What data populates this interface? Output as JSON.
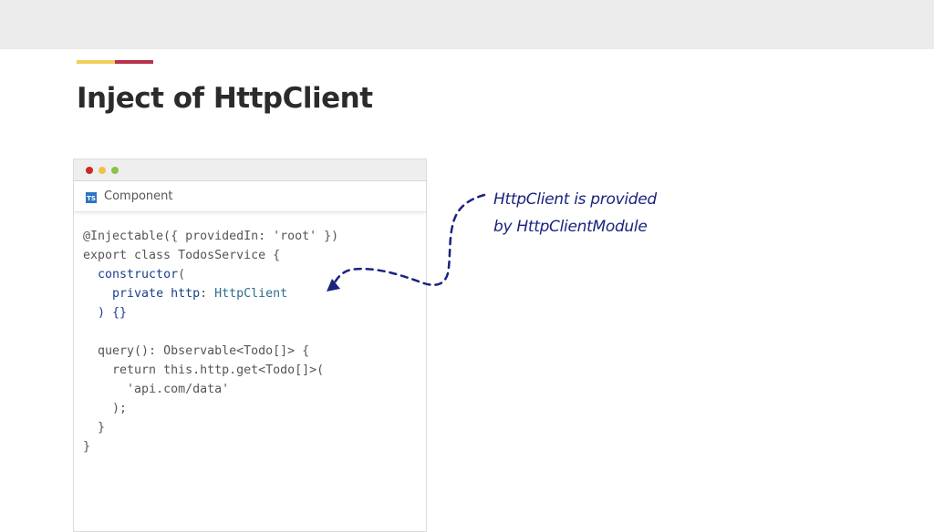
{
  "slide": {
    "title": "Inject of HttpClient",
    "colors": {
      "band": "#ebebeb",
      "accent_yellow": "#f2cd5c",
      "accent_red": "#b8324b",
      "annotation": "#1a237e"
    }
  },
  "editor": {
    "window_dots": [
      "close",
      "minimize",
      "maximize"
    ],
    "tab": {
      "icon": "typescript-icon",
      "icon_text": "TS",
      "label": "Component"
    },
    "code_lines": [
      {
        "indent": "",
        "parts": [
          {
            "text": "@Injectable({ providedIn: 'root' })",
            "style": "plain"
          }
        ]
      },
      {
        "indent": "",
        "parts": [
          {
            "text": "export class TodosService {",
            "style": "plain"
          }
        ]
      },
      {
        "indent": "  ",
        "parts": [
          {
            "text": "constructor",
            "style": "blue"
          },
          {
            "text": "(",
            "style": "plain"
          }
        ]
      },
      {
        "indent": "    ",
        "parts": [
          {
            "text": "private http",
            "style": "blue"
          },
          {
            "text": ": ",
            "style": "plain"
          },
          {
            "text": "HttpClient",
            "style": "type"
          }
        ]
      },
      {
        "indent": "  ",
        "parts": [
          {
            "text": ") {}",
            "style": "blue"
          }
        ]
      },
      {
        "indent": "",
        "parts": [
          {
            "text": "",
            "style": "plain"
          }
        ]
      },
      {
        "indent": "  ",
        "parts": [
          {
            "text": "query(): Observable<Todo[]> {",
            "style": "plain"
          }
        ]
      },
      {
        "indent": "    ",
        "parts": [
          {
            "text": "return this.http.get<Todo[]>(",
            "style": "plain"
          }
        ]
      },
      {
        "indent": "      ",
        "parts": [
          {
            "text": "'api.com/data'",
            "style": "plain"
          }
        ]
      },
      {
        "indent": "    ",
        "parts": [
          {
            "text": ");",
            "style": "plain"
          }
        ]
      },
      {
        "indent": "  ",
        "parts": [
          {
            "text": "}",
            "style": "plain"
          }
        ]
      },
      {
        "indent": "",
        "parts": [
          {
            "text": "}",
            "style": "plain"
          }
        ]
      }
    ]
  },
  "annotation": {
    "line1": "HttpClient is provided",
    "line2": "by HttpClientModule",
    "arrow_icon": "dashed-arrow-icon"
  }
}
